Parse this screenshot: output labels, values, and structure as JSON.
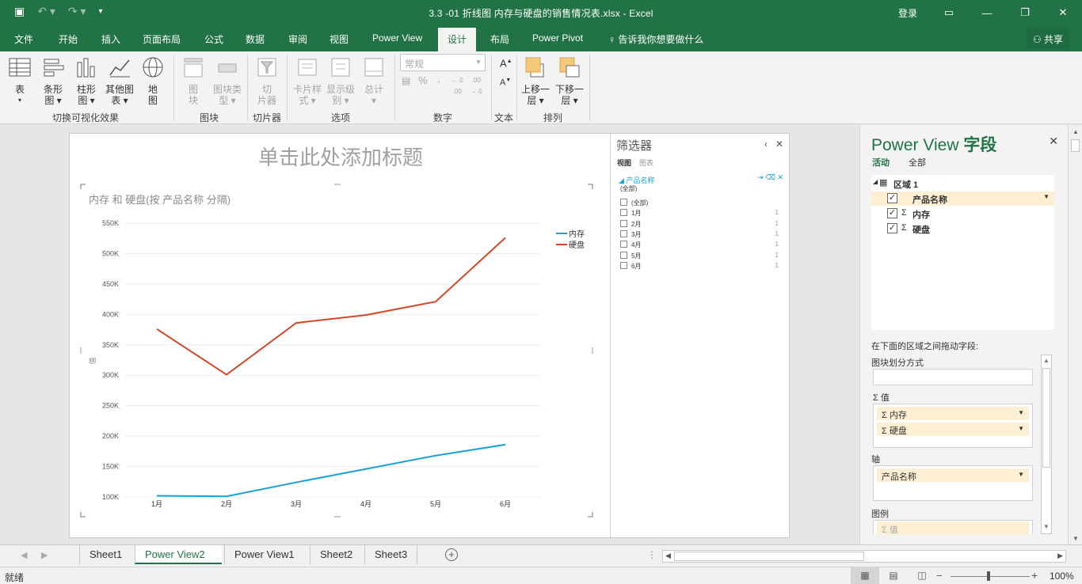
{
  "window": {
    "title": "3.3 -01 折线图 内存与硬盘的销售情况表.xlsx  -  Excel",
    "login": "登录",
    "qat": {
      "save_icon": "save-icon",
      "undo_icon": "undo-icon",
      "redo_icon": "redo-icon"
    }
  },
  "menu": {
    "tabs": [
      "文件",
      "开始",
      "插入",
      "页面布局",
      "公式",
      "数据",
      "审阅",
      "视图",
      "Power View",
      "设计",
      "布局",
      "Power Pivot"
    ],
    "active": "设计",
    "tell_me": "告诉我你想要做什么",
    "share": "共享"
  },
  "ribbon": {
    "switch_group": {
      "label": "切换可视化效果",
      "buttons": [
        {
          "label1": "表",
          "label2": "▾"
        },
        {
          "label1": "条形",
          "label2": "图 ▾"
        },
        {
          "label1": "柱形",
          "label2": "图 ▾"
        },
        {
          "label1": "其他图",
          "label2": "表 ▾"
        },
        {
          "label1": "地",
          "label2": "图"
        }
      ]
    },
    "tiles_group": {
      "label": "图块",
      "buttons": [
        {
          "label1": "图",
          "label2": "块"
        },
        {
          "label1": "图块类",
          "label2": "型 ▾"
        }
      ]
    },
    "slicer_group": {
      "label": "切片器",
      "button1": "切",
      "button2": "片器"
    },
    "options_group": {
      "label": "选项",
      "buttons": [
        {
          "label1": "卡片样",
          "label2": "式 ▾"
        },
        {
          "label1": "显示级",
          "label2": "别 ▾"
        },
        {
          "label1": "总计",
          "label2": "▾"
        }
      ]
    },
    "number_group": {
      "label": "数字",
      "format": "常规",
      "percent": "%",
      "comma": ","
    },
    "text_group": {
      "label": "文本"
    },
    "arrange_group": {
      "label": "排列",
      "buttons": [
        {
          "label1": "上移一",
          "label2": "层 ▾"
        },
        {
          "label1": "下移一",
          "label2": "层 ▾"
        }
      ]
    }
  },
  "view": {
    "title_placeholder": "单击此处添加标题",
    "filters": {
      "title": "筛选器",
      "tab_view": "视图",
      "tab_chart": "图表",
      "field": "产品名称",
      "field_all": "(全部)",
      "items": [
        {
          "label": "(全部)",
          "count": ""
        },
        {
          "label": "1月",
          "count": "1"
        },
        {
          "label": "2月",
          "count": "1"
        },
        {
          "label": "3月",
          "count": "1"
        },
        {
          "label": "4月",
          "count": "1"
        },
        {
          "label": "5月",
          "count": "1"
        },
        {
          "label": "6月",
          "count": "1"
        }
      ]
    }
  },
  "chart_data": {
    "type": "line",
    "title": "内存 和 硬盘(按 产品名称 分隔)",
    "ylabel": "值",
    "categories": [
      "1月",
      "2月",
      "3月",
      "4月",
      "5月",
      "6月"
    ],
    "ylim": [
      100000,
      550000
    ],
    "yticks": [
      "550K",
      "500K",
      "450K",
      "400K",
      "350K",
      "300K",
      "250K",
      "200K",
      "150K",
      "100K"
    ],
    "grid": true,
    "legend": "top-right",
    "series": [
      {
        "name": "内存",
        "color": "#1aa1d8",
        "values": [
          102000,
          101000,
          124000,
          146000,
          168000,
          186000
        ]
      },
      {
        "name": "硬盘",
        "color": "#d24726",
        "values": [
          376000,
          301000,
          386000,
          399000,
          421000,
          526000
        ]
      }
    ]
  },
  "field_pane": {
    "title_prefix": "Power View",
    "title_suffix": "字段",
    "tab_active": "活动",
    "tab_all": "全部",
    "table_name": "区域 1",
    "fields": [
      {
        "name": "产品名称",
        "checked": "✓"
      },
      {
        "name": "内存",
        "checked": "✓"
      },
      {
        "name": "硬盘",
        "checked": "✓"
      }
    ],
    "zones_hint": "在下面的区域之间拖动字段:",
    "tile_by": "图块划分方式",
    "values_label": "Σ 值",
    "values": [
      "Σ 内存",
      "Σ 硬盘"
    ],
    "axis_label": "轴",
    "axis": [
      "产品名称"
    ],
    "legend_label": "图例",
    "legend_items": [
      "Σ 值"
    ]
  },
  "sheets": {
    "tabs": [
      "Sheet1",
      "Power View2",
      "Power View1",
      "Sheet2",
      "Sheet3"
    ],
    "active": "Power View2"
  },
  "status": {
    "ready": "就绪",
    "zoom": "100%"
  }
}
